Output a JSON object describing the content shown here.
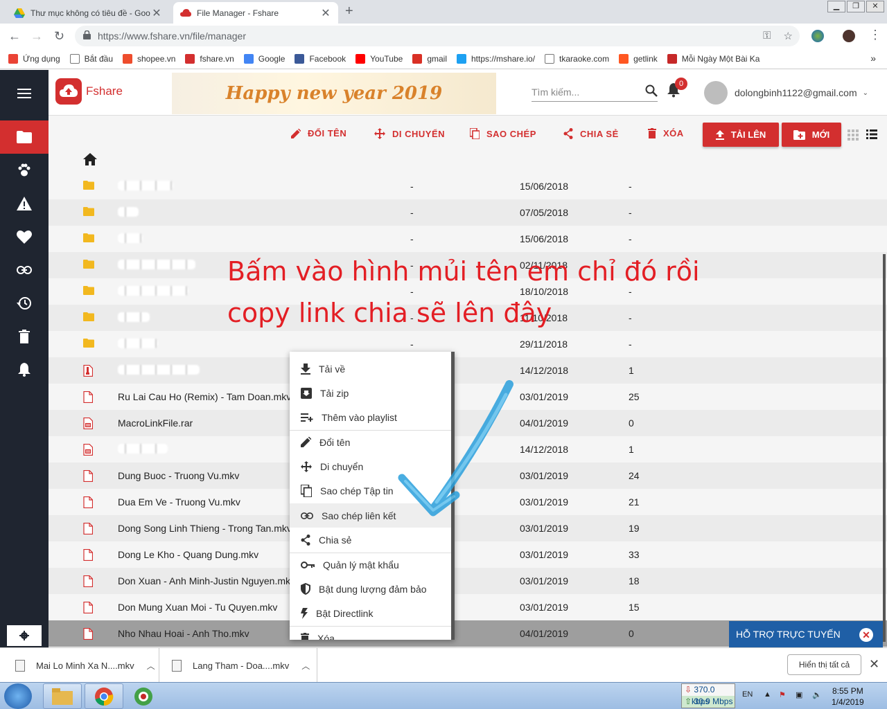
{
  "browser": {
    "tabs": [
      {
        "title": "Thư mục không có tiêu đề - Goo"
      },
      {
        "title": "File Manager - Fshare"
      }
    ],
    "url": "https://www.fshare.vn/file/manager",
    "bookmarks": [
      {
        "label": "Ứng dụng",
        "color": "#ea4335"
      },
      {
        "label": "Bắt đầu",
        "color": "#fff"
      },
      {
        "label": "shopee.vn",
        "color": "#ee4d2d"
      },
      {
        "label": "fshare.vn",
        "color": "#d32f2f"
      },
      {
        "label": "Google",
        "color": "#4285f4"
      },
      {
        "label": "Facebook",
        "color": "#3b5998"
      },
      {
        "label": "YouTube",
        "color": "#ff0000"
      },
      {
        "label": "gmail",
        "color": "#d93025"
      },
      {
        "label": "https://mshare.io/",
        "color": "#1da1f2"
      },
      {
        "label": "tkaraoke.com",
        "color": "#fff"
      },
      {
        "label": "getlink",
        "color": "#ff5722"
      },
      {
        "label": "Mỗi Ngày Một Bài Ka",
        "color": "#c62828"
      }
    ]
  },
  "header": {
    "logo_text": "Fshare",
    "banner_text": "Happy new year 2019",
    "search_placeholder": "Tìm kiếm...",
    "notification_count": "0",
    "user_email": "dolongbinh1122@gmail.com"
  },
  "toolbar": {
    "rename": "ĐỔI TÊN",
    "move": "DI CHUYỂN",
    "copy": "SAO CHÉP",
    "share": "CHIA SẺ",
    "delete": "XÓA",
    "upload": "TẢI LÊN",
    "new": "MỚI"
  },
  "files": [
    {
      "name": "",
      "size": "-",
      "date": "15/06/2018",
      "dl": "-",
      "type": "folder"
    },
    {
      "name": "",
      "size": "-",
      "date": "07/05/2018",
      "dl": "-",
      "type": "folder"
    },
    {
      "name": "",
      "size": "-",
      "date": "15/06/2018",
      "dl": "-",
      "type": "folder"
    },
    {
      "name": "",
      "size": "-",
      "date": "02/11/2018",
      "dl": "-",
      "type": "folder"
    },
    {
      "name": "",
      "size": "-",
      "date": "18/10/2018",
      "dl": "-",
      "type": "folder"
    },
    {
      "name": "",
      "size": "-",
      "date": "11/10/2018",
      "dl": "-",
      "type": "folder"
    },
    {
      "name": "",
      "size": "-",
      "date": "29/11/2018",
      "dl": "-",
      "type": "folder"
    },
    {
      "name": "",
      "size": "",
      "date": "14/12/2018",
      "dl": "1",
      "type": "zip"
    },
    {
      "name": "Ru Lai Cau Ho (Remix) - Tam Doan.mkv",
      "size": "",
      "date": "03/01/2019",
      "dl": "25",
      "type": "file"
    },
    {
      "name": "MacroLinkFile.rar",
      "size": "",
      "date": "04/01/2019",
      "dl": "0",
      "type": "rar"
    },
    {
      "name": "",
      "size": "",
      "date": "14/12/2018",
      "dl": "1",
      "type": "rar"
    },
    {
      "name": "Dung Buoc - Truong Vu.mkv",
      "size": "",
      "date": "03/01/2019",
      "dl": "24",
      "type": "file"
    },
    {
      "name": "Dua Em Ve - Truong Vu.mkv",
      "size": "",
      "date": "03/01/2019",
      "dl": "21",
      "type": "file"
    },
    {
      "name": "Dong Song Linh Thieng - Trong Tan.mkv",
      "size": "",
      "date": "03/01/2019",
      "dl": "19",
      "type": "file"
    },
    {
      "name": "Dong Le Kho - Quang Dung.mkv",
      "size": "",
      "date": "03/01/2019",
      "dl": "33",
      "type": "file"
    },
    {
      "name": "Don Xuan - Anh Minh-Justin Nguyen.mkv",
      "size": "",
      "date": "03/01/2019",
      "dl": "18",
      "type": "file"
    },
    {
      "name": "Don Mung Xuan Moi - Tu Quyen.mkv",
      "size": "",
      "date": "03/01/2019",
      "dl": "15",
      "type": "file"
    },
    {
      "name": "Nho Nhau Hoai - Anh Tho.mkv",
      "size": "",
      "date": "04/01/2019",
      "dl": "0",
      "type": "file"
    }
  ],
  "annotation": {
    "line1": "Bấm vào hình mủi tên em chỉ đó rồi",
    "line2": "copy link chia sẽ lên đây"
  },
  "context_menu": {
    "download": "Tải về",
    "zip": "Tải zip",
    "playlist": "Thêm vào playlist",
    "rename": "Đổi tên",
    "move": "Di chuyển",
    "copy_file": "Sao chép Tập tin",
    "copy_link": "Sao chép liên kết",
    "share": "Chia sẻ",
    "password": "Quản lý mật khẩu",
    "secure": "Bật  dung lượng đảm bảo",
    "directlink": "Bật  Directlink",
    "delete": "Xóa"
  },
  "chat": {
    "label": "HỖ TRỢ TRỰC TUYẾN"
  },
  "downloads": {
    "items": [
      "Mai Lo Minh Xa N....mkv",
      "Lang Tham - Doa....mkv"
    ],
    "show_all": "Hiển thị tất cả"
  },
  "taskbar": {
    "down_speed": "370.0 kbps",
    "up_speed": "30.9 Mbps",
    "lang": "EN",
    "time": "8:55 PM",
    "date": "1/4/2019"
  },
  "colors": {
    "accent": "#d32f2f",
    "sidebar": "#1f2530",
    "chat": "#1f5fa6"
  }
}
